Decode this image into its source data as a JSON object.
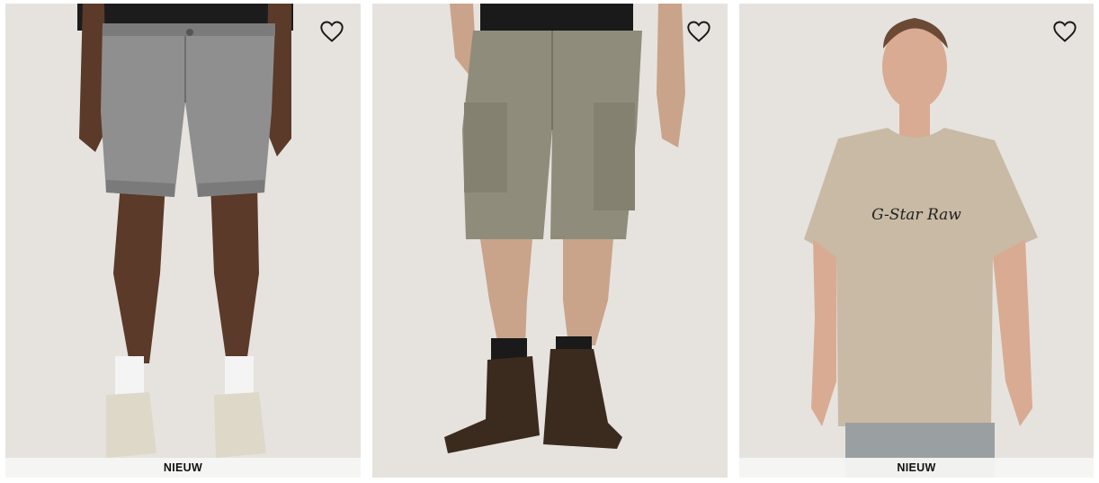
{
  "products": [
    {
      "id": "denim-shorts",
      "badge": "NIEUW",
      "wishlist_icon": "heart-outline-icon",
      "shorts_color": "#8f8f8f",
      "skin_color": "#5b3a29"
    },
    {
      "id": "cargo-shorts",
      "badge": "",
      "wishlist_icon": "heart-outline-icon",
      "shorts_color": "#908c7c",
      "skin_color": "#c9a48a"
    },
    {
      "id": "graphic-tshirt",
      "badge": "NIEUW",
      "wishlist_icon": "heart-outline-icon",
      "shirt_color": "#c9baa5",
      "print_text": "G-Star Raw"
    }
  ],
  "colors": {
    "card_background": "#e6e3de",
    "badge_background": "#f6f5f3",
    "icon_stroke": "#1a1a1a"
  }
}
